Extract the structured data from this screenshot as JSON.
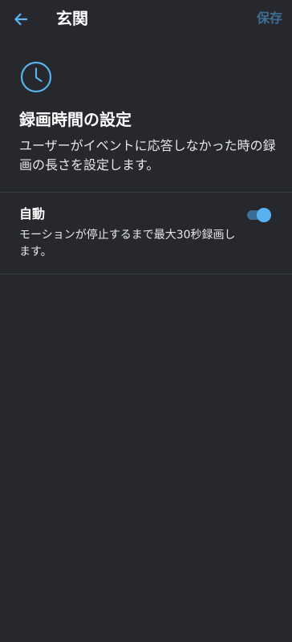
{
  "header": {
    "back_icon": "arrow-left-icon",
    "title": "玄関",
    "save_label": "保存"
  },
  "section": {
    "icon": "clock-icon",
    "title": "録画時間の設定",
    "description": "ユーザーがイベントに応答しなかった時の録画の長さを設定します。"
  },
  "option": {
    "title": "自動",
    "description": "モーションが停止するまで最大30秒録画します。",
    "toggle_on": true
  },
  "colors": {
    "background": "#26282d",
    "accent": "#59b2f0",
    "save_disabled": "#3d6f93"
  }
}
